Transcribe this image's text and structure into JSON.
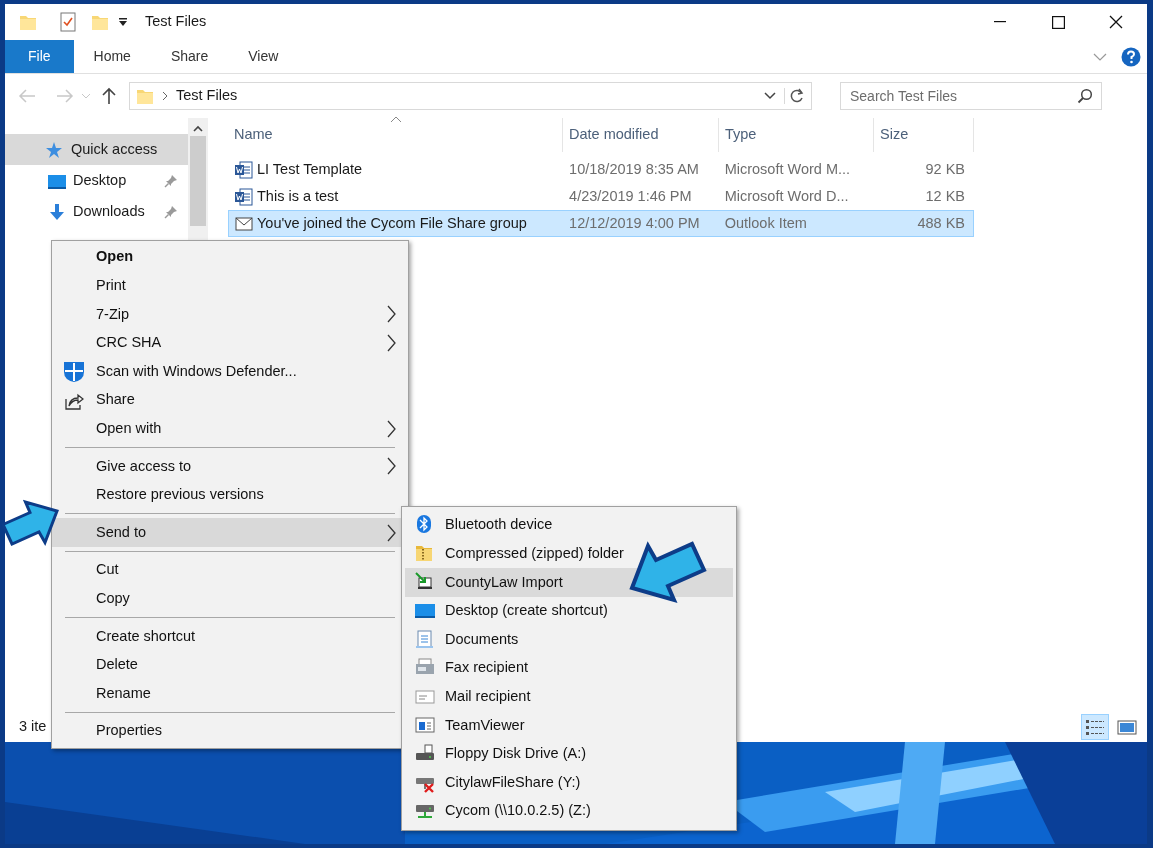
{
  "window": {
    "title": "Test Files"
  },
  "ribbon_tabs": [
    {
      "label": "File",
      "kind": "file",
      "selected": false
    },
    {
      "label": "Home",
      "kind": "tab",
      "selected": false
    },
    {
      "label": "Share",
      "kind": "tab",
      "selected": false
    },
    {
      "label": "View",
      "kind": "tab",
      "selected": false
    }
  ],
  "address": {
    "path": "Test Files"
  },
  "search": {
    "placeholder": "Search Test Files"
  },
  "sidebar": {
    "items": [
      {
        "label": "Quick access",
        "kind": "star",
        "selected": true,
        "pinned": false
      },
      {
        "label": "Desktop",
        "kind": "desktop",
        "selected": false,
        "pinned": true
      },
      {
        "label": "Downloads",
        "kind": "download",
        "selected": false,
        "pinned": true
      }
    ]
  },
  "table": {
    "columns": [
      "Name",
      "Date modified",
      "Type",
      "Size"
    ],
    "rows": [
      {
        "name": "LI Test Template",
        "date": "10/18/2019 8:35 AM",
        "type": "Microsoft Word M...",
        "size": "92 KB",
        "kind": "word",
        "selected": false
      },
      {
        "name": "This is a test",
        "date": "4/23/2019 1:46 PM",
        "type": "Microsoft Word D...",
        "size": "12 KB",
        "kind": "word",
        "selected": false
      },
      {
        "name": "You've joined the Cycom File Share group",
        "date": "12/12/2019 4:00 PM",
        "type": "Outlook Item",
        "size": "488 KB",
        "kind": "mail",
        "selected": true
      }
    ]
  },
  "status_bar": {
    "text": "3 ite"
  },
  "view_buttons": [
    {
      "kind": "details",
      "selected": true
    },
    {
      "kind": "large",
      "selected": false
    }
  ],
  "context_menu": {
    "groups": [
      [
        {
          "label": "Open",
          "bold": true,
          "submenu": false,
          "selected": false
        },
        {
          "label": "Print",
          "bold": false,
          "submenu": false,
          "selected": false
        },
        {
          "label": "7-Zip",
          "bold": false,
          "submenu": true,
          "selected": false
        },
        {
          "label": "CRC SHA",
          "bold": false,
          "submenu": true,
          "selected": false
        },
        {
          "label": "Scan with Windows Defender...",
          "kind": "defender",
          "bold": false,
          "submenu": false,
          "selected": false
        },
        {
          "label": "Share",
          "kind": "share",
          "bold": false,
          "submenu": false,
          "selected": false
        },
        {
          "label": "Open with",
          "bold": false,
          "submenu": true,
          "selected": false
        }
      ],
      [
        {
          "label": "Give access to",
          "bold": false,
          "submenu": true,
          "selected": false
        },
        {
          "label": "Restore previous versions",
          "bold": false,
          "submenu": false,
          "selected": false
        }
      ],
      [
        {
          "label": "Send to",
          "bold": false,
          "submenu": true,
          "selected": true
        }
      ],
      [
        {
          "label": "Cut",
          "bold": false,
          "submenu": false,
          "selected": false
        },
        {
          "label": "Copy",
          "bold": false,
          "submenu": false,
          "selected": false
        }
      ],
      [
        {
          "label": "Create shortcut",
          "bold": false,
          "submenu": false,
          "selected": false
        },
        {
          "label": "Delete",
          "bold": false,
          "submenu": false,
          "selected": false
        },
        {
          "label": "Rename",
          "bold": false,
          "submenu": false,
          "selected": false
        }
      ],
      [
        {
          "label": "Properties",
          "bold": false,
          "submenu": false,
          "selected": false
        }
      ]
    ]
  },
  "send_to_menu": {
    "items": [
      {
        "label": "Bluetooth device",
        "kind": "bluetooth",
        "selected": false
      },
      {
        "label": "Compressed (zipped) folder",
        "kind": "zip",
        "selected": false
      },
      {
        "label": "CountyLaw Import",
        "kind": "import",
        "selected": true
      },
      {
        "label": "Desktop (create shortcut)",
        "kind": "desktop",
        "selected": false
      },
      {
        "label": "Documents",
        "kind": "documents",
        "selected": false
      },
      {
        "label": "Fax recipient",
        "kind": "fax",
        "selected": false
      },
      {
        "label": "Mail recipient",
        "kind": "mail",
        "selected": false
      },
      {
        "label": "TeamViewer",
        "kind": "teamviewer",
        "selected": false
      },
      {
        "label": "Floppy Disk Drive (A:)",
        "kind": "floppy",
        "selected": false
      },
      {
        "label": "CitylawFileShare (Y:)",
        "kind": "netdown",
        "selected": false
      },
      {
        "label": "Cycom (\\\\10.0.2.5) (Z:)",
        "kind": "netup",
        "selected": false
      }
    ]
  }
}
